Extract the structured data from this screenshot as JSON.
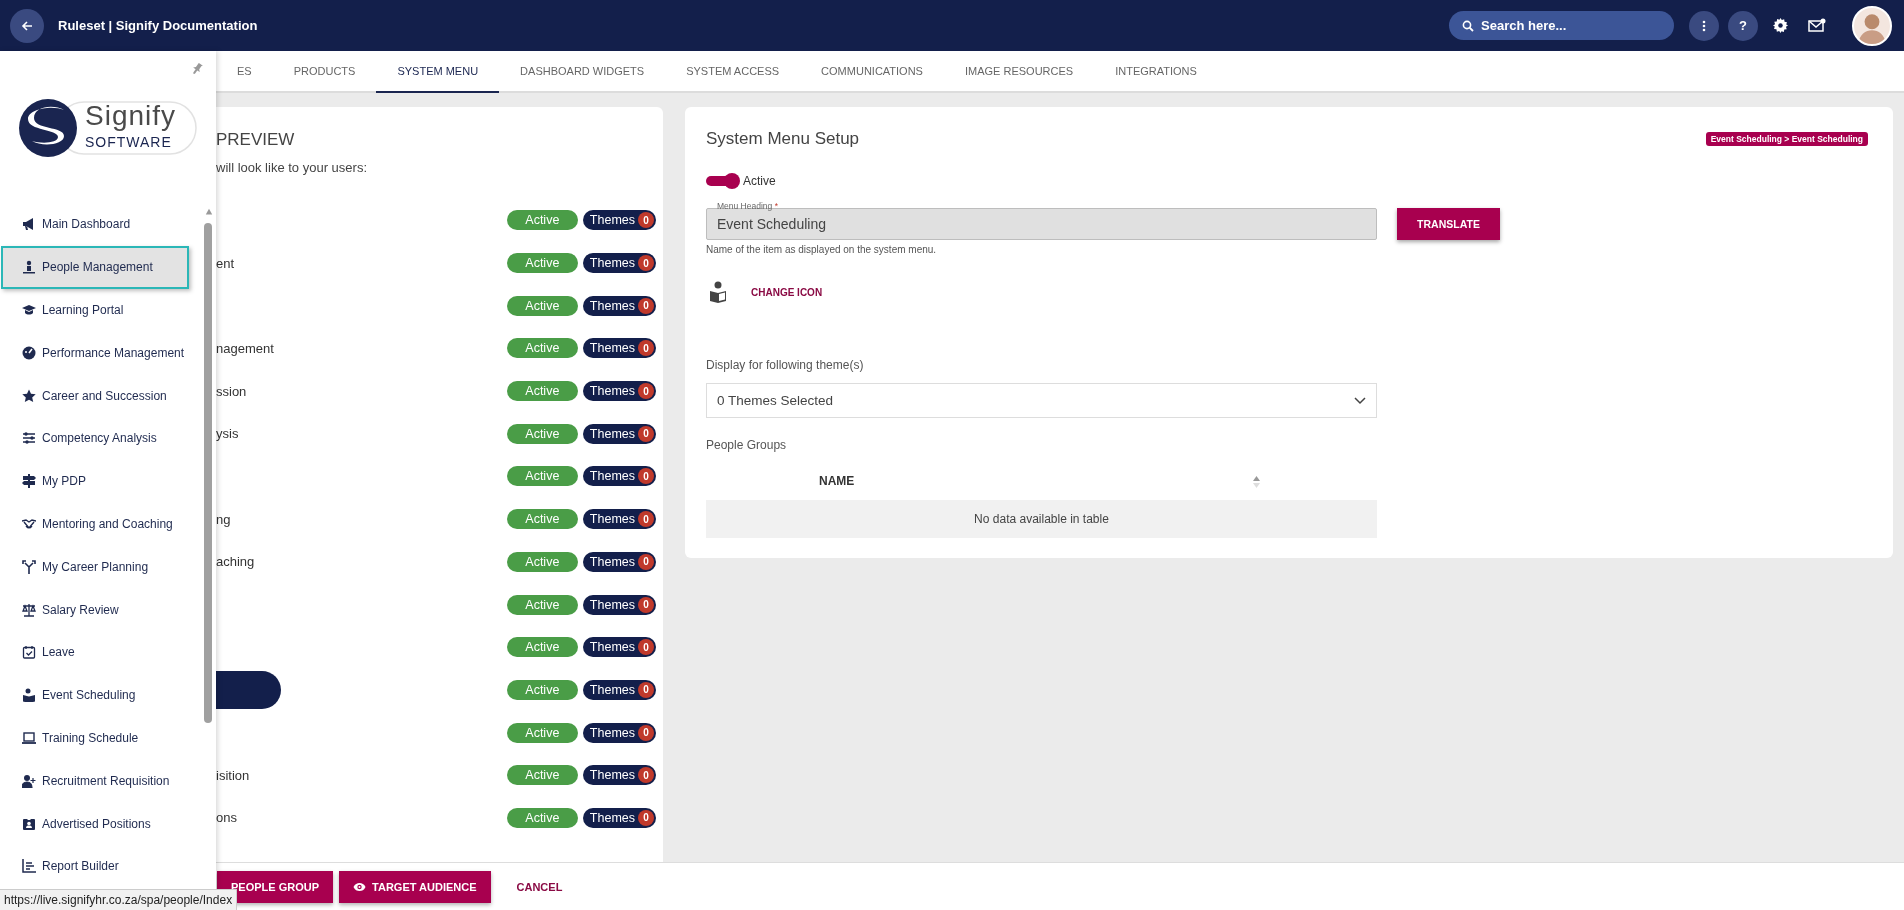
{
  "top_bar": {
    "title": "Ruleset | Signify Documentation",
    "search": {
      "placeholder": "Search here..."
    },
    "help_label": "?"
  },
  "tabs": [
    {
      "label": "ES",
      "selected": false
    },
    {
      "label": "PRODUCTS",
      "selected": false
    },
    {
      "label": "SYSTEM MENU",
      "selected": true
    },
    {
      "label": "DASHBOARD WIDGETS",
      "selected": false
    },
    {
      "label": "SYSTEM ACCESS",
      "selected": false
    },
    {
      "label": "COMMUNICATIONS",
      "selected": false
    },
    {
      "label": "IMAGE RESOURCES",
      "selected": false
    },
    {
      "label": "INTEGRATIONS",
      "selected": false
    }
  ],
  "preview": {
    "title": "PREVIEW",
    "subtitle": "will look like to your users:",
    "rows": [
      {
        "status": "Active",
        "themes": "Themes",
        "count": "0",
        "selected": false
      },
      {
        "label": "ent",
        "status": "Active",
        "themes": "Themes",
        "count": "0",
        "selected": false
      },
      {
        "status": "Active",
        "themes": "Themes",
        "count": "0",
        "selected": false
      },
      {
        "label": "nagement",
        "status": "Active",
        "themes": "Themes",
        "count": "0",
        "selected": false
      },
      {
        "label": "ssion",
        "status": "Active",
        "themes": "Themes",
        "count": "0",
        "selected": false
      },
      {
        "label": "ysis",
        "status": "Active",
        "themes": "Themes",
        "count": "0",
        "selected": false
      },
      {
        "status": "Active",
        "themes": "Themes",
        "count": "0",
        "selected": false
      },
      {
        "label": "ng",
        "status": "Active",
        "themes": "Themes",
        "count": "0",
        "selected": false
      },
      {
        "label": "aching",
        "status": "Active",
        "themes": "Themes",
        "count": "0",
        "selected": false
      },
      {
        "status": "Active",
        "themes": "Themes",
        "count": "0",
        "selected": false
      },
      {
        "status": "Active",
        "themes": "Themes",
        "count": "0",
        "selected": false
      },
      {
        "status": "Active",
        "themes": "Themes",
        "count": "0",
        "selected": true
      },
      {
        "status": "Active",
        "themes": "Themes",
        "count": "0",
        "selected": false
      },
      {
        "label": "isition",
        "status": "Active",
        "themes": "Themes",
        "count": "0",
        "selected": false
      },
      {
        "label": "ons",
        "status": "Active",
        "themes": "Themes",
        "count": "0",
        "selected": false
      }
    ]
  },
  "setup": {
    "title": "System Menu Setup",
    "breadcrumb": "Event Scheduling > Event Scheduling",
    "active_toggle": {
      "label": "Active",
      "on": true
    },
    "menu_heading": {
      "label": "Menu Heading",
      "required_mark": "*",
      "value": "Event Scheduling",
      "hint": "Name of the item as displayed on the system menu.",
      "disabled": true
    },
    "translate_button": "TRANSLATE",
    "change_icon_link": "CHANGE ICON",
    "themes": {
      "label": "Display for following theme(s)",
      "value": "0 Themes Selected"
    },
    "people_groups": {
      "label": "People Groups",
      "columns": [
        "NAME"
      ],
      "empty_message": "No data available in table"
    }
  },
  "sidebar": {
    "logo": {
      "name": "Signify",
      "tagline": "SOFTWARE"
    },
    "items": [
      {
        "label": "Main Dashboard",
        "selected": false
      },
      {
        "label": "People Management",
        "selected": true
      },
      {
        "label": "Learning Portal",
        "selected": false
      },
      {
        "label": "Performance Management",
        "selected": false
      },
      {
        "label": "Career and Succession",
        "selected": false
      },
      {
        "label": "Competency Analysis",
        "selected": false
      },
      {
        "label": "My PDP",
        "selected": false
      },
      {
        "label": "Mentoring and Coaching",
        "selected": false
      },
      {
        "label": "My Career Planning",
        "selected": false
      },
      {
        "label": "Salary Review",
        "selected": false
      },
      {
        "label": "Leave",
        "selected": false
      },
      {
        "label": "Event Scheduling",
        "selected": false
      },
      {
        "label": "Training Schedule",
        "selected": false
      },
      {
        "label": "Recruitment Requisition",
        "selected": false
      },
      {
        "label": "Advertised Positions",
        "selected": false
      },
      {
        "label": "Report Builder",
        "selected": false
      }
    ]
  },
  "actions": [
    {
      "label": "PEOPLE GROUP",
      "kind": "primary"
    },
    {
      "label": "TARGET AUDIENCE",
      "kind": "primary-eye"
    },
    {
      "label": "CANCEL",
      "kind": "link"
    }
  ],
  "status_url": "https://live.signifyhr.co.za/spa/people/Index"
}
